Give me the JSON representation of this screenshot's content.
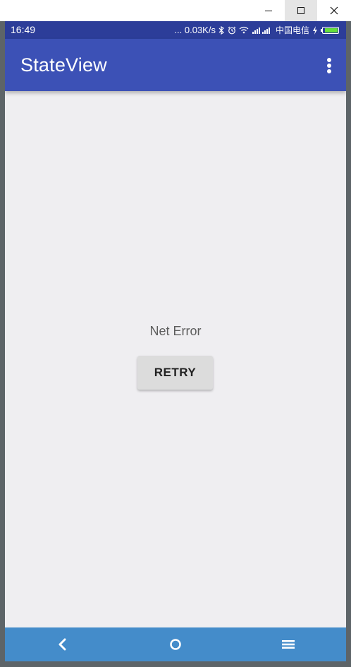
{
  "status_bar": {
    "time": "16:49",
    "network_speed": "... 0.03K/s",
    "carrier": "中国电信"
  },
  "toolbar": {
    "title": "StateView"
  },
  "content": {
    "error_text": "Net Error",
    "retry_label": "RETRY"
  },
  "colors": {
    "status_bar": "#2c3d99",
    "toolbar": "#3c51b6",
    "background": "#efeef1",
    "nav_bar": "#448cca",
    "battery": "#66e03a"
  },
  "icons": {
    "window": [
      "minimize-icon",
      "maximize-icon",
      "close-icon"
    ],
    "status": [
      "bluetooth-icon",
      "alarm-icon",
      "wifi-icon",
      "signal-icon",
      "charging-icon",
      "battery-icon"
    ],
    "toolbar": [
      "more-vert-icon"
    ],
    "nav": [
      "back-icon",
      "home-icon",
      "menu-icon"
    ]
  }
}
